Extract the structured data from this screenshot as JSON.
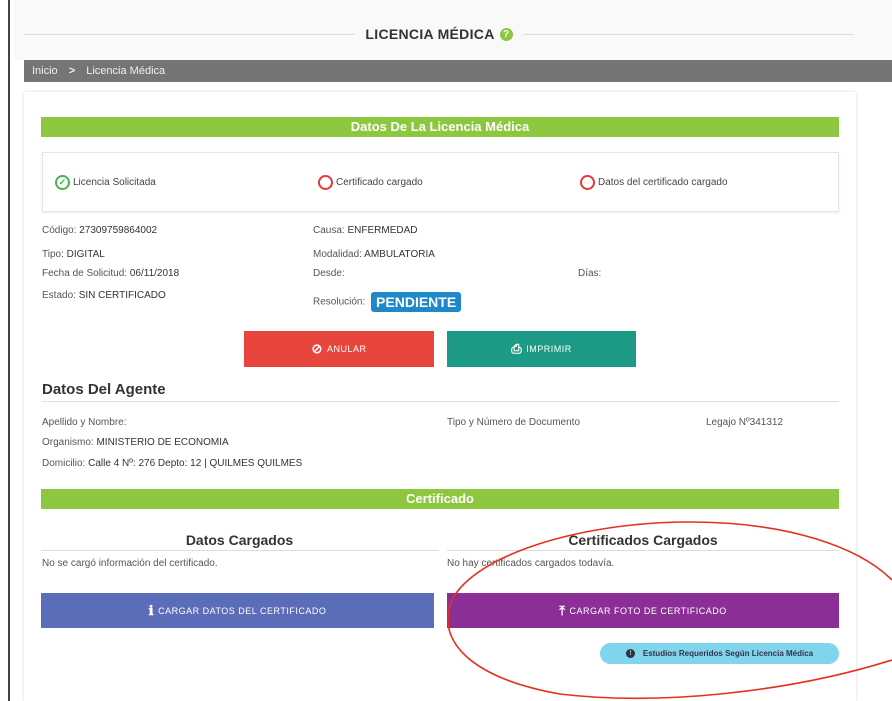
{
  "header": {
    "title": "LICENCIA MÉDICA",
    "help_icon": "?"
  },
  "breadcrumb": {
    "home": "Inicio",
    "separator": ">",
    "current": "Licencia Médica"
  },
  "license_section": {
    "header": "Datos De La Licencia Médica",
    "steps": [
      {
        "label": "Licencia Solicitada",
        "status": "done"
      },
      {
        "label": "Certificado cargado",
        "status": "pending"
      },
      {
        "label": "Datos del certificado cargado",
        "status": "pending"
      }
    ],
    "fields": {
      "codigo_label": "Código:",
      "codigo": "27309759864002",
      "tipo_label": "Tipo:",
      "tipo": "DIGITAL",
      "fecha_label": "Fecha de Solicitud:",
      "fecha": "06/11/2018",
      "estado_label": "Estado:",
      "estado": "SIN CERTIFICADO",
      "causa_label": "Causa:",
      "causa": "ENFERMEDAD",
      "modalidad_label": "Modalidad:",
      "modalidad": "AMBULATORIA",
      "desde_label": "Desde:",
      "dias_label": "Días:",
      "resolucion_label": "Resolución:",
      "resolucion": "PENDIENTE"
    },
    "buttons": {
      "anular": "ANULAR",
      "imprimir": "IMPRIMIR"
    }
  },
  "agent_section": {
    "title": "Datos Del Agente",
    "apellido_label": "Apellido y Nombre:",
    "documento_label": "Tipo y Número de Documento",
    "legajo": "Legajo Nº341312",
    "organismo_label": "Organismo:",
    "organismo": "MINISTERIO DE ECONOMIA",
    "domicilio_label": "Domicilio:",
    "domicilio": "Calle 4 Nº: 276 Depto: 12 | QUILMES QUILMES"
  },
  "certificate_section": {
    "header": "Certificado",
    "datos_title": "Datos Cargados",
    "datos_empty": "No se cargó información del certificado.",
    "certs_title": "Certificados Cargados",
    "certs_empty": "No hay certificados cargados todavía.",
    "btn_cargar_datos": "CARGAR DATOS DEL CERTIFICADO",
    "btn_cargar_foto": "CARGAR FOTO DE CERTIFICADO",
    "info_pill": "Estudios Requeridos Según Licencia Médica"
  },
  "colors": {
    "green": "#8dc63f",
    "red": "#e8453c",
    "teal": "#1d9a85",
    "blue": "#5b6cb8",
    "purple": "#8b2f96",
    "badge": "#1e88c8",
    "pill": "#80d4ec",
    "annotation": "#e53020"
  }
}
